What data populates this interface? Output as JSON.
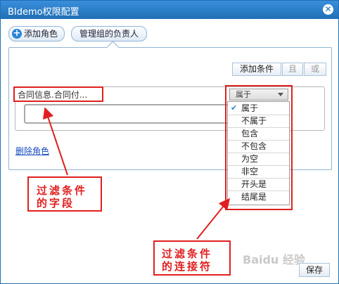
{
  "window": {
    "title": "BIdemo权限配置",
    "close_icon": "close-icon"
  },
  "tabs": {
    "add_role": "添加角色",
    "manager": "管理组的负责人"
  },
  "toolbar": {
    "add_condition": "添加条件",
    "and": "且",
    "or": "或"
  },
  "condition": {
    "field": "合同信息.合同付...",
    "operator": "属于",
    "value": ""
  },
  "operator_options": [
    {
      "label": "属于",
      "checked": true
    },
    {
      "label": "不属于",
      "checked": false
    },
    {
      "label": "包含",
      "checked": false
    },
    {
      "label": "不包含",
      "checked": false
    },
    {
      "label": "为空",
      "checked": false
    },
    {
      "label": "非空",
      "checked": false
    },
    {
      "label": "开头是",
      "checked": false
    },
    {
      "label": "结尾是",
      "checked": false
    }
  ],
  "delete_role": "删除角色",
  "callouts": {
    "field_line1": "过滤条件",
    "field_line2": "的字段",
    "op_line1": "过滤条件",
    "op_line2": "的连接符"
  },
  "save": "保存",
  "watermark": "Baidu 经验",
  "colors": {
    "accent": "#1f6fb5",
    "annotation": "#e02020"
  }
}
